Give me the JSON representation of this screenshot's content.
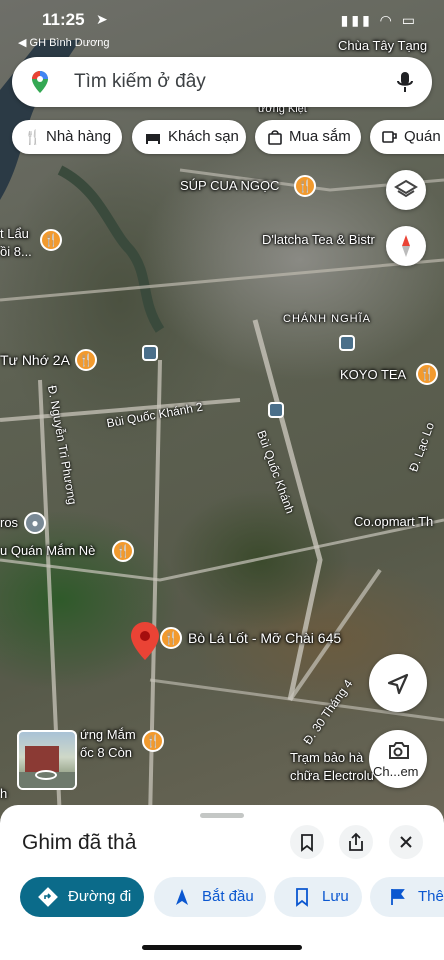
{
  "status_bar": {
    "time": "11:25",
    "back_app": "◀ GH Bình Dương"
  },
  "search": {
    "placeholder": "Tìm kiếm ở đây"
  },
  "chips": [
    {
      "label": "Nhà hàng",
      "icon": "fork-knife-icon"
    },
    {
      "label": "Khách sạn",
      "icon": "bed-icon"
    },
    {
      "label": "Mua sắm",
      "icon": "shopping-bag-icon"
    },
    {
      "label": "Quán c",
      "icon": "coffee-cup-icon"
    }
  ],
  "map": {
    "places": [
      {
        "label": "Chùa Tây Tạng"
      },
      {
        "label": "SÚP CUA NGỌC"
      },
      {
        "label": "D'latcha Tea & Bistr"
      },
      {
        "label": "CHÁNH NGHĨA"
      },
      {
        "label": "KOYO TEA"
      },
      {
        "label": "t Lẩu"
      },
      {
        "label": "ồi 8..."
      },
      {
        "label": "Tư Nhớ 2A"
      },
      {
        "label": "ros"
      },
      {
        "label": "u Quán Mắm Nè"
      },
      {
        "label": "Co.opmart Th"
      },
      {
        "label": "Bò Lá Lốt - Mỡ Chài 645"
      },
      {
        "label": "ứng Mắm"
      },
      {
        "label": "ốc 8 Còn"
      },
      {
        "label": "Trạm bảo hà"
      },
      {
        "label": "chữa Electrolu"
      },
      {
        "label": "ương Kiệt"
      },
      {
        "label": "h"
      }
    ],
    "streets": [
      {
        "label": "Bùi Quốc Khánh 2"
      },
      {
        "label": "Bùi Quốc Khánh"
      },
      {
        "label": "Đ. Nguyễn Tri Phương"
      },
      {
        "label": "Đ. 30 Tháng 4"
      },
      {
        "label": "Đ. Lạc Lo"
      }
    ],
    "lens_label": "Ch...em"
  },
  "sheet": {
    "title": "Ghim đã thả",
    "actions": [
      {
        "label": "Đường đi",
        "icon": "directions-icon"
      },
      {
        "label": "Bắt đầu",
        "icon": "navigation-arrow-icon"
      },
      {
        "label": "Lưu",
        "icon": "bookmark-icon"
      },
      {
        "label": "Thê",
        "icon": "flag-icon"
      }
    ]
  },
  "colors": {
    "accent": "#0b6b8a",
    "poi": "#f29a2e",
    "pin": "#ea4335"
  }
}
